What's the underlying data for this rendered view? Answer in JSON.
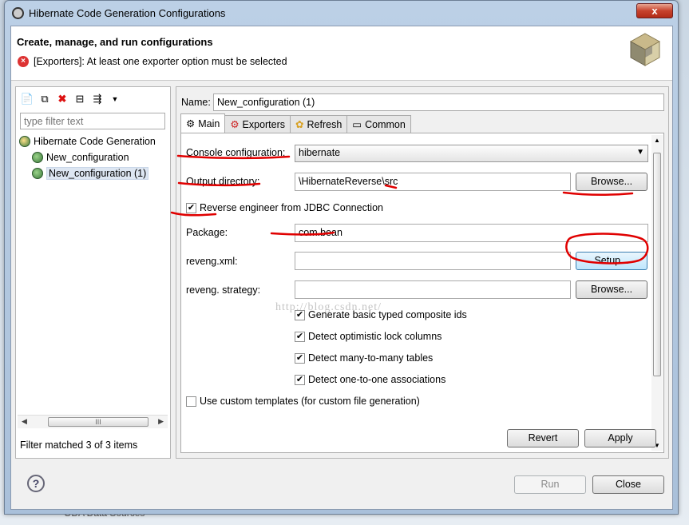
{
  "window": {
    "title": "Hibernate Code Generation Configurations",
    "close_glyph": "x"
  },
  "banner": {
    "title": "Create, manage, and run configurations",
    "message": "[Exporters]: At least one exporter option must be selected"
  },
  "left": {
    "filter_placeholder": "type filter text",
    "tree": [
      {
        "label": "Hibernate Code Generation"
      },
      {
        "label": "New_configuration"
      },
      {
        "label": "New_configuration (1)"
      }
    ],
    "scroll_thumb": "III",
    "status": "Filter matched 3 of 3 items"
  },
  "right": {
    "name_label": "Name:",
    "name_value": "New_configuration (1)",
    "tabs": [
      {
        "label": "Main"
      },
      {
        "label": "Exporters"
      },
      {
        "label": "Refresh"
      },
      {
        "label": "Common"
      }
    ],
    "console_label": "Console configuration:",
    "console_value": "hibernate",
    "output_label": "Output directory:",
    "output_value": "\\HibernateReverse\\src",
    "browse_label": "Browse...",
    "reverse_label": "Reverse engineer from JDBC Connection",
    "package_label": "Package:",
    "package_value": "com.bean",
    "reveng_xml_label": "reveng.xml:",
    "reveng_xml_value": "",
    "setup_label": "Setup...",
    "reveng_strategy_label": "reveng. strategy:",
    "reveng_strategy_value": "",
    "browse2_label": "Browse...",
    "options": [
      {
        "label": "Generate basic typed composite ids"
      },
      {
        "label": "Detect optimistic lock columns"
      },
      {
        "label": "Detect many-to-many tables"
      },
      {
        "label": "Detect one-to-one associations"
      }
    ],
    "custom_templates_label": "Use custom templates (for custom file generation)",
    "watermark": "http://blog.csdn.net/"
  },
  "buttons": {
    "revert": "Revert",
    "apply": "Apply",
    "run": "Run",
    "close": "Close",
    "help": "?"
  },
  "background": {
    "item": "ODA Data Sources"
  },
  "colors": {
    "annotation": "#e00000",
    "error": "#dd3333",
    "selection": "#dde6f2"
  }
}
